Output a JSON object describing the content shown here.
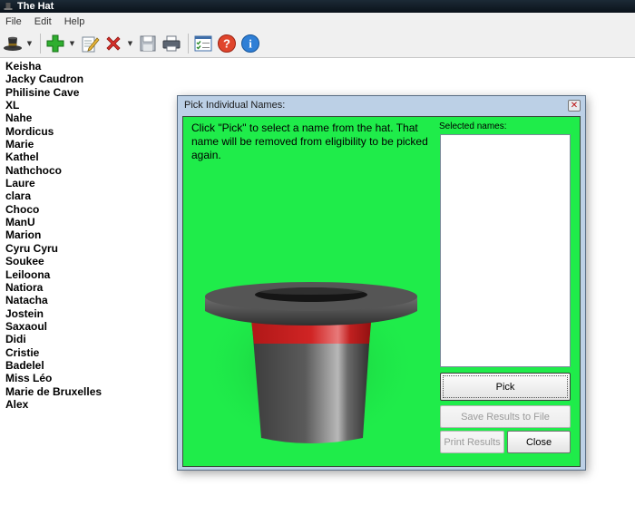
{
  "window": {
    "title": "The Hat"
  },
  "menu": {
    "items": [
      "File",
      "Edit",
      "Help"
    ]
  },
  "toolbar": {
    "buttons": [
      "hat-icon",
      "add-icon",
      "edit-icon",
      "delete-icon",
      "save-icon",
      "print-icon",
      "checklist-icon",
      "help-icon",
      "info-icon"
    ]
  },
  "names": [
    "Keisha",
    "Jacky Caudron",
    "Philisine Cave",
    "XL",
    "Nahe",
    "Mordicus",
    "Marie",
    "Kathel",
    "Nathchoco",
    "Laure",
    "clara",
    "Choco",
    "ManU",
    "Marion",
    "Cyru Cyru",
    "Soukee",
    "Leiloona",
    "Natiora",
    "Natacha",
    "Jostein",
    "Saxaoul",
    "Didi",
    "Cristie",
    "Badelel",
    "Miss Léo",
    "Marie de Bruxelles",
    "Alex"
  ],
  "dialog": {
    "title": "Pick Individual Names:",
    "close_glyph": "✕",
    "instructions": "Click \"Pick\" to select a name from the hat. That name will be removed from eligibility to be picked again.",
    "selected_label": "Selected names:",
    "selected_names": [],
    "pick_label": "Pick",
    "save_label": "Save Results to File",
    "print_label": "Print Results",
    "close_label": "Close",
    "background_color": "#1fec4a"
  }
}
